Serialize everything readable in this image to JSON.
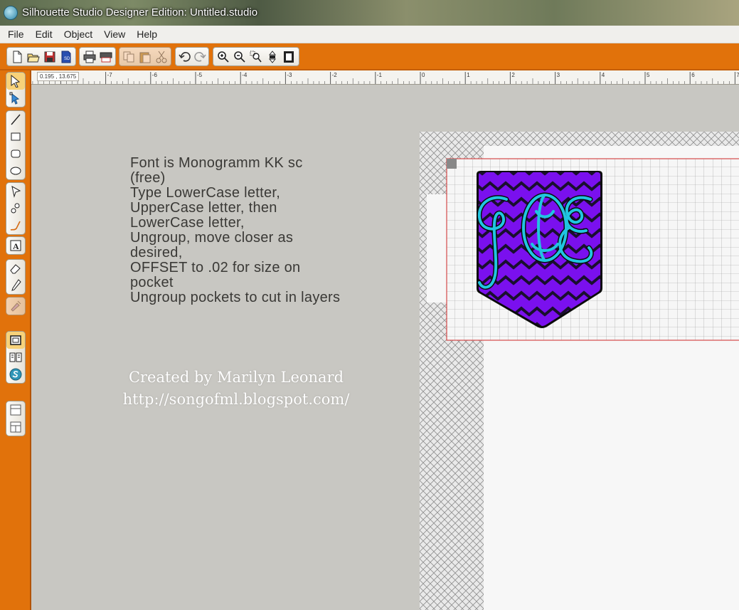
{
  "window": {
    "title": "Silhouette Studio Designer Edition: Untitled.studio"
  },
  "menu": {
    "items": [
      "File",
      "Edit",
      "Object",
      "View",
      "Help"
    ]
  },
  "toolbar": {
    "groups": [
      [
        "new-document-icon",
        "open-icon",
        "save-icon",
        "save-to-sd-icon"
      ],
      [
        "print-icon",
        "print-cut-icon"
      ],
      [
        "copy-icon",
        "paste-icon",
        "cut-icon"
      ],
      [
        "undo-icon",
        "redo-icon"
      ],
      [
        "zoom-in-icon",
        "zoom-out-icon",
        "zoom-select-icon",
        "pan-icon",
        "fit-page-icon"
      ]
    ]
  },
  "left_tools": {
    "groups": [
      [
        "select-arrow-icon",
        "point-edit-icon"
      ],
      [
        "line-tool-icon",
        "rectangle-tool-icon",
        "rounded-rectangle-tool-icon",
        "ellipse-tool-icon"
      ],
      [
        "polygon-tool-icon",
        "curve-tool-icon",
        "freehand-tool-icon"
      ],
      [
        "text-tool-icon"
      ],
      [
        "eraser-tool-icon",
        "knife-tool-icon"
      ],
      [
        "fill-color-icon"
      ],
      [
        "page-setup-icon",
        "library-icon",
        "silhouette-store-icon"
      ],
      [
        "panel-single-icon",
        "panel-split-icon"
      ]
    ]
  },
  "ruler": {
    "coords": "0.195 , 13.675",
    "labels": [
      "-7",
      "-6",
      "-5",
      "-4",
      "-3",
      "-2",
      "-1",
      "0",
      "1",
      "2",
      "3",
      "4",
      "5",
      "6",
      "7"
    ]
  },
  "canvas": {
    "note_lines": [
      "Font is Monogramm KK sc",
      "(free)",
      "Type LowerCase letter,",
      "UpperCase letter, then",
      "LowerCase letter,",
      "Ungroup, move closer as",
      "desired,",
      "OFFSET to .02 for size on",
      "pocket",
      "Ungroup pockets to cut in layers"
    ],
    "credit_lines": [
      "Created by Marilyn Leonard",
      "http://songofml.blogspot.com/"
    ],
    "monogram": {
      "letters": [
        "J",
        "O",
        "E"
      ],
      "pocket_fill": "#7a10ee",
      "chevron_color": "#1a0f2e",
      "letter_color": "#20c5e0",
      "outline_color": "#0b0b0b"
    }
  },
  "colors": {
    "toolbar_orange": "#e1720b",
    "canvas_gray": "#c8c7c2",
    "cut_border_red": "#d44a4a"
  }
}
